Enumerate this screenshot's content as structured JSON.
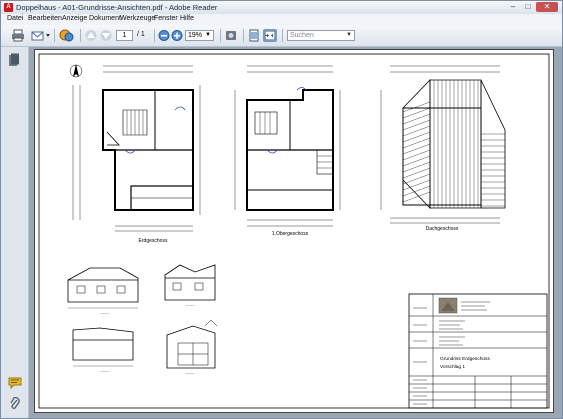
{
  "window": {
    "title": "Doppelhaus - A01-Grundrisse-Ansichten.pdf - Adobe Reader"
  },
  "menu": [
    "Datei",
    "Bearbeiten",
    "Anzeige",
    "Dokument",
    "Werkzeuge",
    "Fenster",
    "Hilfe"
  ],
  "toolbar": {
    "page_current": "1",
    "page_total": "/ 1",
    "zoom": "19%",
    "search_placeholder": "Suchen"
  },
  "drawing": {
    "plan_labels": [
      "Erdgeschoss",
      "1.Obergeschoss",
      "Dachgeschoss"
    ],
    "title_block": {
      "title_line1": "Grundriss Erdgeschoss",
      "title_line2": "Vorschlag 1"
    }
  },
  "icons": {
    "print": "printer-icon",
    "email": "email-icon",
    "collaborate": "collaborate-icon",
    "prev": "arrow-up-icon",
    "next": "arrow-down-icon",
    "zoom_out": "zoom-out-icon",
    "zoom_in": "zoom-in-icon",
    "sign": "sign-icon",
    "fit_page": "fit-page-icon",
    "fit_width": "fit-width-icon",
    "pages": "pages-panel-icon",
    "comment": "comment-icon",
    "attach": "paperclip-icon"
  }
}
